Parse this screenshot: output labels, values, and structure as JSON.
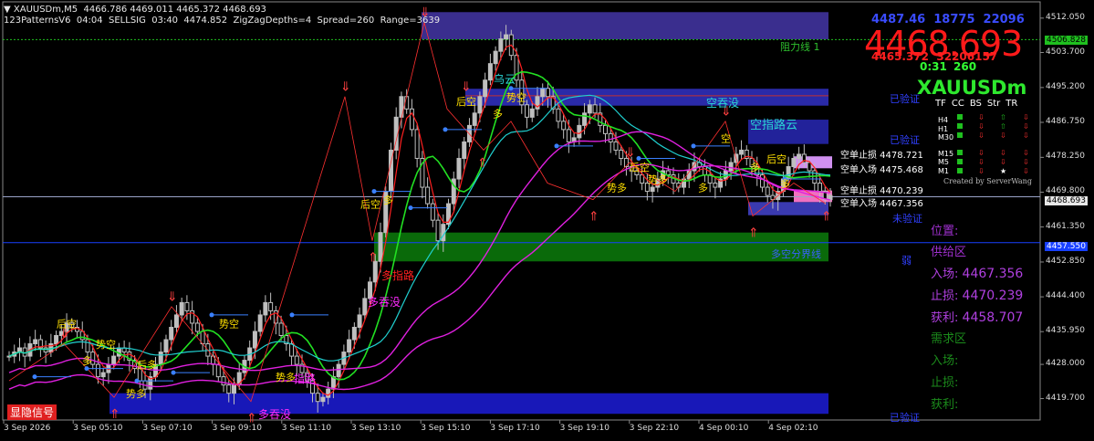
{
  "header": {
    "line1": "XAUUSDm,M5  4466.786 4469.011 4465.372 4468.693",
    "line2": "123PatternsV6  04:04  SELLSIG  03:40  4474.852  ZigZagDepths=4  Spread=260  Range=3639"
  },
  "price_panel": {
    "small_ticks": "4487.46  18775  22096",
    "big_price": "4468.693",
    "sub_line": "4465.372  32206157",
    "timer": "0:31",
    "spread": "260",
    "symbol": "XAUUSDm",
    "tf_headers": [
      "TF",
      "CC",
      "BS",
      "Str",
      "TR"
    ],
    "tf_rows": [
      "H4",
      "H1",
      "M30",
      "M15",
      "M5",
      "M1"
    ],
    "created_by": "Created by ServerWang"
  },
  "trade_info": {
    "position_label": "位置:",
    "supply_label": "供给区",
    "entry_label": "入场:",
    "entry_value": "4467.356",
    "stop_label": "止损:",
    "stop_value": "4470.239",
    "profit_label": "获利:",
    "profit_value": "4458.707",
    "demand_label": "需求区",
    "entry2_label": "入场:",
    "stop2_label": "止损:",
    "profit2_label": "获利:"
  },
  "chart_labels": {
    "resistance": "阻力线 1",
    "verified1": "已验证",
    "verified2": "已验证",
    "verified3": "已验证",
    "unverified": "未验证",
    "divider": "多空分界线",
    "weak": "弱",
    "toggle_signal": "显隐信号",
    "wu_yun": "乌云",
    "kong_tun_mo": "空吞没",
    "kong_zhi_wu_yun": "空指路云",
    "duo_zhi_lu": "多指路",
    "duo_tun_mo": "多吞没",
    "duo_tun_mo2": "多吞没",
    "zhi_lu": "指路",
    "short_stop1": "空单止损 4478.721",
    "short_entry1": "空单入场 4475.468",
    "short_stop2": "空单止损 4470.239",
    "short_entry2": "空单入场 4467.356"
  },
  "signal_text": {
    "kong": "空",
    "duo": "多",
    "hou_kong": "后空",
    "shi_kong": "势空",
    "hou_duo": "后多",
    "shi_duo": "势多"
  },
  "chart_data": {
    "type": "candlestick",
    "symbol": "XAUUSDm",
    "timeframe": "M5",
    "ylim": [
      4414.5,
      4516.0
    ],
    "yticks": [
      4512.05,
      4503.7,
      4495.2,
      4486.75,
      4478.25,
      4469.8,
      4461.35,
      4452.85,
      4444.4,
      4435.95,
      4428.0,
      4419.7
    ],
    "ytick_labels": [
      "4512.050",
      "4503.700",
      "4495.200",
      "4486.750",
      "4478.250",
      "4469.800",
      "4461.350",
      "4452.850",
      "4444.400",
      "4435.950",
      "4428.000",
      "4419.700"
    ],
    "xticks": [
      "3 Sep 2026",
      "3 Sep 05:10",
      "3 Sep 07:10",
      "3 Sep 09:10",
      "3 Sep 11:10",
      "3 Sep 13:10",
      "3 Sep 15:10",
      "3 Sep 17:10",
      "3 Sep 19:10",
      "3 Sep 22:10",
      "4 Sep 00:10",
      "4 Sep 02:10"
    ],
    "price_line": 4468.693,
    "price_line_label": "4468.693",
    "resistance_line": 4506.828,
    "resistance_label": "4506.828",
    "divider_line": 4457.55,
    "divider_label": "4457.550",
    "closes": [
      4430,
      4431,
      4432,
      4430,
      4433,
      4434,
      4432,
      4431,
      4433,
      4435,
      4436,
      4438,
      4437,
      4436,
      4434,
      4431,
      4428,
      4425,
      4426,
      4428,
      4430,
      4432,
      4431,
      4429,
      4427,
      4424,
      4422,
      4425,
      4428,
      4431,
      4434,
      4437,
      4440,
      4443,
      4441,
      4438,
      4436,
      4433,
      4430,
      4428,
      4425,
      4423,
      4421,
      4423,
      4426,
      4429,
      4432,
      4436,
      4440,
      4443,
      4441,
      4438,
      4435,
      4433,
      4430,
      4428,
      4426,
      4424,
      4421,
      4419,
      4420,
      4422,
      4425,
      4428,
      4431,
      4434,
      4437,
      4440,
      4444,
      4448,
      4453,
      4460,
      4470,
      4480,
      4488,
      4493,
      4490,
      4485,
      4478,
      4471,
      4467,
      4463,
      4458,
      4462,
      4467,
      4473,
      4478,
      4482,
      4486,
      4489,
      4493,
      4497,
      4501,
      4504,
      4507,
      4508,
      4503,
      4497,
      4491,
      4488,
      4490,
      4493,
      4495,
      4493,
      4490,
      4487,
      4485,
      4482,
      4483,
      4486,
      4489,
      4491,
      4489,
      4486,
      4484,
      4482,
      4480,
      4478,
      4476,
      4475,
      4474,
      4472,
      4470,
      4471,
      4473,
      4475,
      4474,
      4472,
      4471,
      4473,
      4475,
      4477,
      4476,
      4474,
      4472,
      4471,
      4473,
      4475,
      4477,
      4479,
      4480,
      4478,
      4476,
      4474,
      4471,
      4469,
      4468,
      4470,
      4473,
      4476,
      4478,
      4479,
      4477,
      4475,
      4472,
      4470,
      4468,
      4469
    ]
  }
}
